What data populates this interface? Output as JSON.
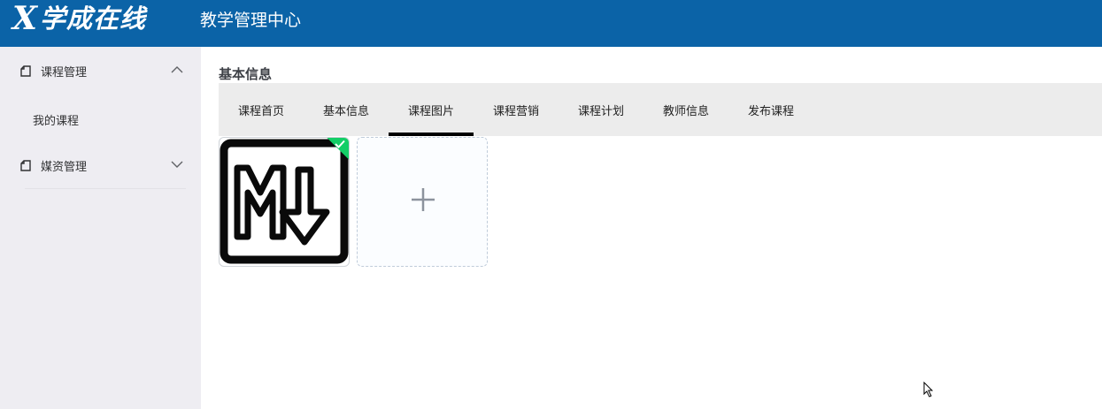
{
  "header": {
    "logo_x": "X",
    "logo_brand": "学成在线",
    "subtitle": "教学管理中心",
    "bg_color": "#0b63a7"
  },
  "sidebar": {
    "menus": [
      {
        "label": "课程管理",
        "icon": "document-icon",
        "expanded": true,
        "items": [
          {
            "label": "我的课程"
          }
        ]
      },
      {
        "label": "媒资管理",
        "icon": "document-icon",
        "expanded": false,
        "items": []
      }
    ]
  },
  "main": {
    "section_title": "基本信息",
    "tabs": [
      {
        "label": "课程首页",
        "active": false
      },
      {
        "label": "基本信息",
        "active": false
      },
      {
        "label": "课程图片",
        "active": true
      },
      {
        "label": "课程营销",
        "active": false
      },
      {
        "label": "课程计划",
        "active": false
      },
      {
        "label": "教师信息",
        "active": false
      },
      {
        "label": "发布课程",
        "active": false
      }
    ],
    "images": {
      "uploaded": [
        {
          "icon": "markdown-logo-icon",
          "status": "success",
          "status_color": "#13ce66"
        }
      ],
      "uploader_icon": "plus-icon"
    }
  }
}
